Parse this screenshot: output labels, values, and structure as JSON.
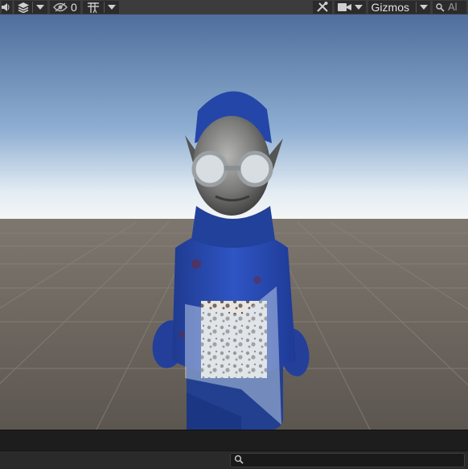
{
  "toolbar": {
    "hidden_count": "0",
    "gizmos_label": "Gizmos",
    "search_prefix": "Al"
  },
  "hierarchy_search": {
    "placeholder": ""
  }
}
